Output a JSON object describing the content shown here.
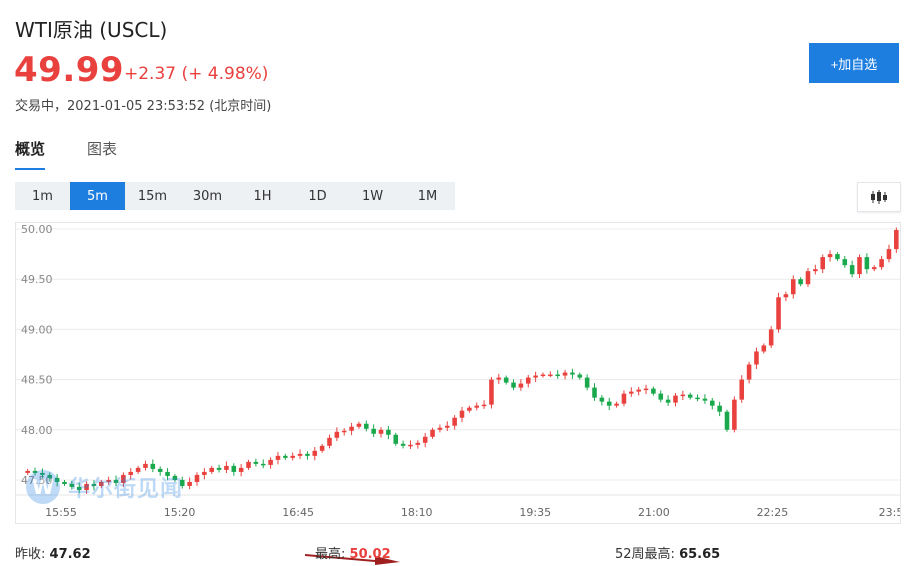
{
  "header": {
    "title": "WTI原油 (USCL)",
    "price": "49.99",
    "change": "+2.37 (+ 4.98%)",
    "status": "交易中，2021-01-05 23:53:52 (北京时间)",
    "add_watch_label": "+加自选"
  },
  "tabs": [
    {
      "label": "概览",
      "active": true
    },
    {
      "label": "图表",
      "active": false
    }
  ],
  "intervals": [
    {
      "label": "1m",
      "active": false
    },
    {
      "label": "5m",
      "active": true
    },
    {
      "label": "15m",
      "active": false
    },
    {
      "label": "30m",
      "active": false
    },
    {
      "label": "1H",
      "active": false
    },
    {
      "label": "1D",
      "active": false
    },
    {
      "label": "1W",
      "active": false
    },
    {
      "label": "1M",
      "active": false
    }
  ],
  "watermark": "华尔街见闻",
  "stats": {
    "prev_close_label": "昨收:",
    "prev_close": "47.62",
    "high_label": "最高:",
    "high": "50.02",
    "week52_high_label": "52周最高:",
    "week52_high": "65.65"
  },
  "colors": {
    "up": "#e8413e",
    "down": "#1aa84c",
    "accent": "#1e7ee0"
  },
  "chart_data": {
    "type": "candlestick",
    "y_ticks": [
      "50.00",
      "49.50",
      "49.00",
      "48.50",
      "48.00",
      "47.50"
    ],
    "x_ticks": [
      "15:55",
      "15:20",
      "16:45",
      "18:10",
      "19:35",
      "21:00",
      "22:25",
      "23:5"
    ],
    "ylim": [
      47.35,
      50.06
    ],
    "grid": true,
    "closes": [
      47.59,
      47.57,
      47.55,
      47.52,
      47.48,
      47.46,
      47.43,
      47.4,
      47.46,
      47.44,
      47.48,
      47.5,
      47.47,
      47.55,
      47.58,
      47.62,
      47.66,
      47.61,
      47.58,
      47.54,
      47.5,
      47.44,
      47.48,
      47.55,
      47.58,
      47.62,
      47.6,
      47.64,
      47.58,
      47.62,
      47.68,
      47.66,
      47.65,
      47.7,
      47.74,
      47.72,
      47.74,
      47.76,
      47.74,
      47.79,
      47.84,
      47.92,
      47.98,
      47.99,
      48.03,
      48.06,
      48.01,
      47.96,
      48.0,
      47.95,
      47.86,
      47.84,
      47.85,
      47.87,
      47.93,
      48.0,
      48.02,
      48.04,
      48.12,
      48.19,
      48.22,
      48.24,
      48.25,
      48.5,
      48.52,
      48.47,
      48.42,
      48.46,
      48.52,
      48.54,
      48.55,
      48.55,
      48.54,
      48.57,
      48.55,
      48.52,
      48.42,
      48.32,
      48.28,
      48.24,
      48.26,
      48.36,
      48.38,
      48.4,
      48.41,
      48.36,
      48.3,
      48.27,
      48.34,
      48.35,
      48.32,
      48.31,
      48.29,
      48.24,
      48.18,
      48.0,
      48.3,
      48.5,
      48.65,
      48.78,
      48.84,
      49.0,
      49.32,
      49.35,
      49.5,
      49.45,
      49.58,
      49.6,
      49.72,
      49.75,
      49.7,
      49.64,
      49.55,
      49.72,
      49.6,
      49.62,
      49.7,
      49.8,
      49.99
    ]
  }
}
